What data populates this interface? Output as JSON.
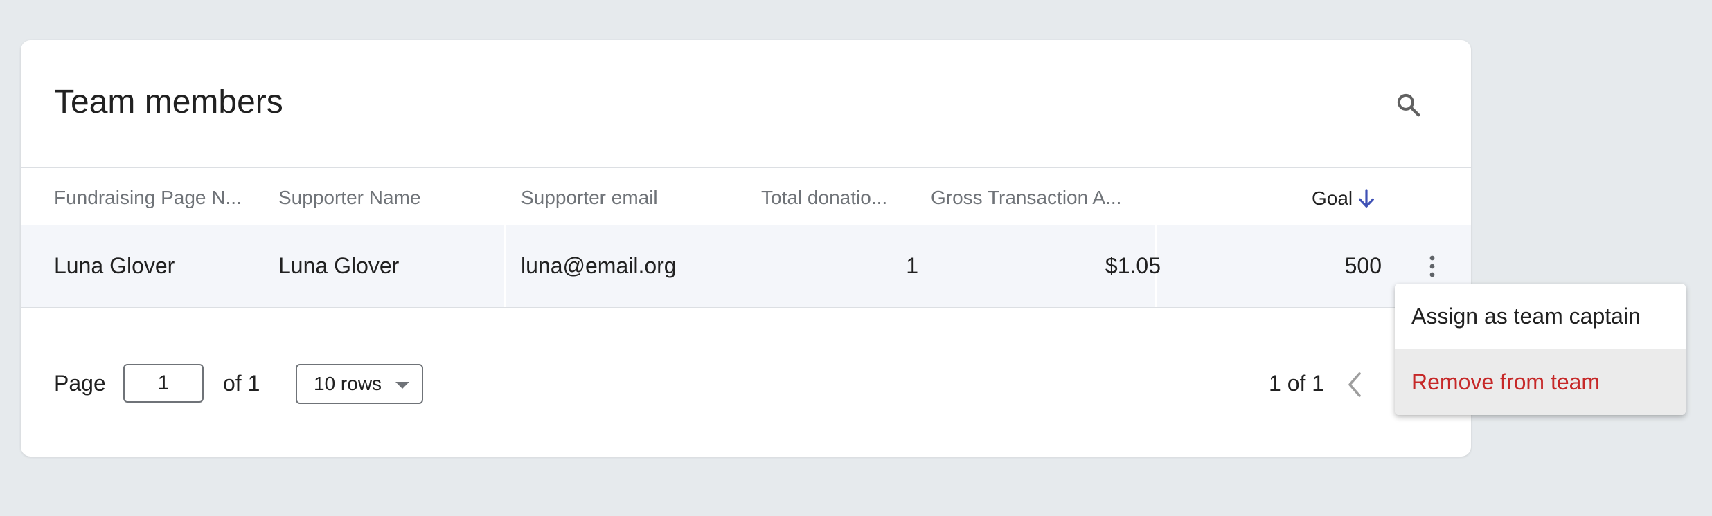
{
  "card": {
    "title": "Team members"
  },
  "icons": {
    "search": "search-icon",
    "sort": "arrow-down-icon",
    "more": "more-vert-icon",
    "prev": "chevron-left-icon",
    "caret": "caret-down-icon"
  },
  "colors": {
    "accent": "#3f51b5",
    "danger": "#c62828",
    "row_bg": "#f4f6fa",
    "page_bg": "#e6eaed"
  },
  "table": {
    "columns": [
      "Fundraising Page N...",
      "Supporter Name",
      "Supporter email",
      "Total donatio...",
      "Gross Transaction A...",
      "Goal"
    ],
    "sorted_column": "Goal",
    "sort_direction": "descending",
    "rows": [
      [
        "Luna Glover",
        "Luna Glover",
        "luna@email.org",
        "1",
        "$1.05",
        "500"
      ]
    ]
  },
  "pagination": {
    "page_label": "Page",
    "page_value": "1",
    "of_label": "of 1",
    "rows_per_page": "10 rows",
    "range_label": "1 of 1"
  },
  "context_menu": {
    "items": [
      "Assign as team captain",
      "Remove from team"
    ]
  }
}
